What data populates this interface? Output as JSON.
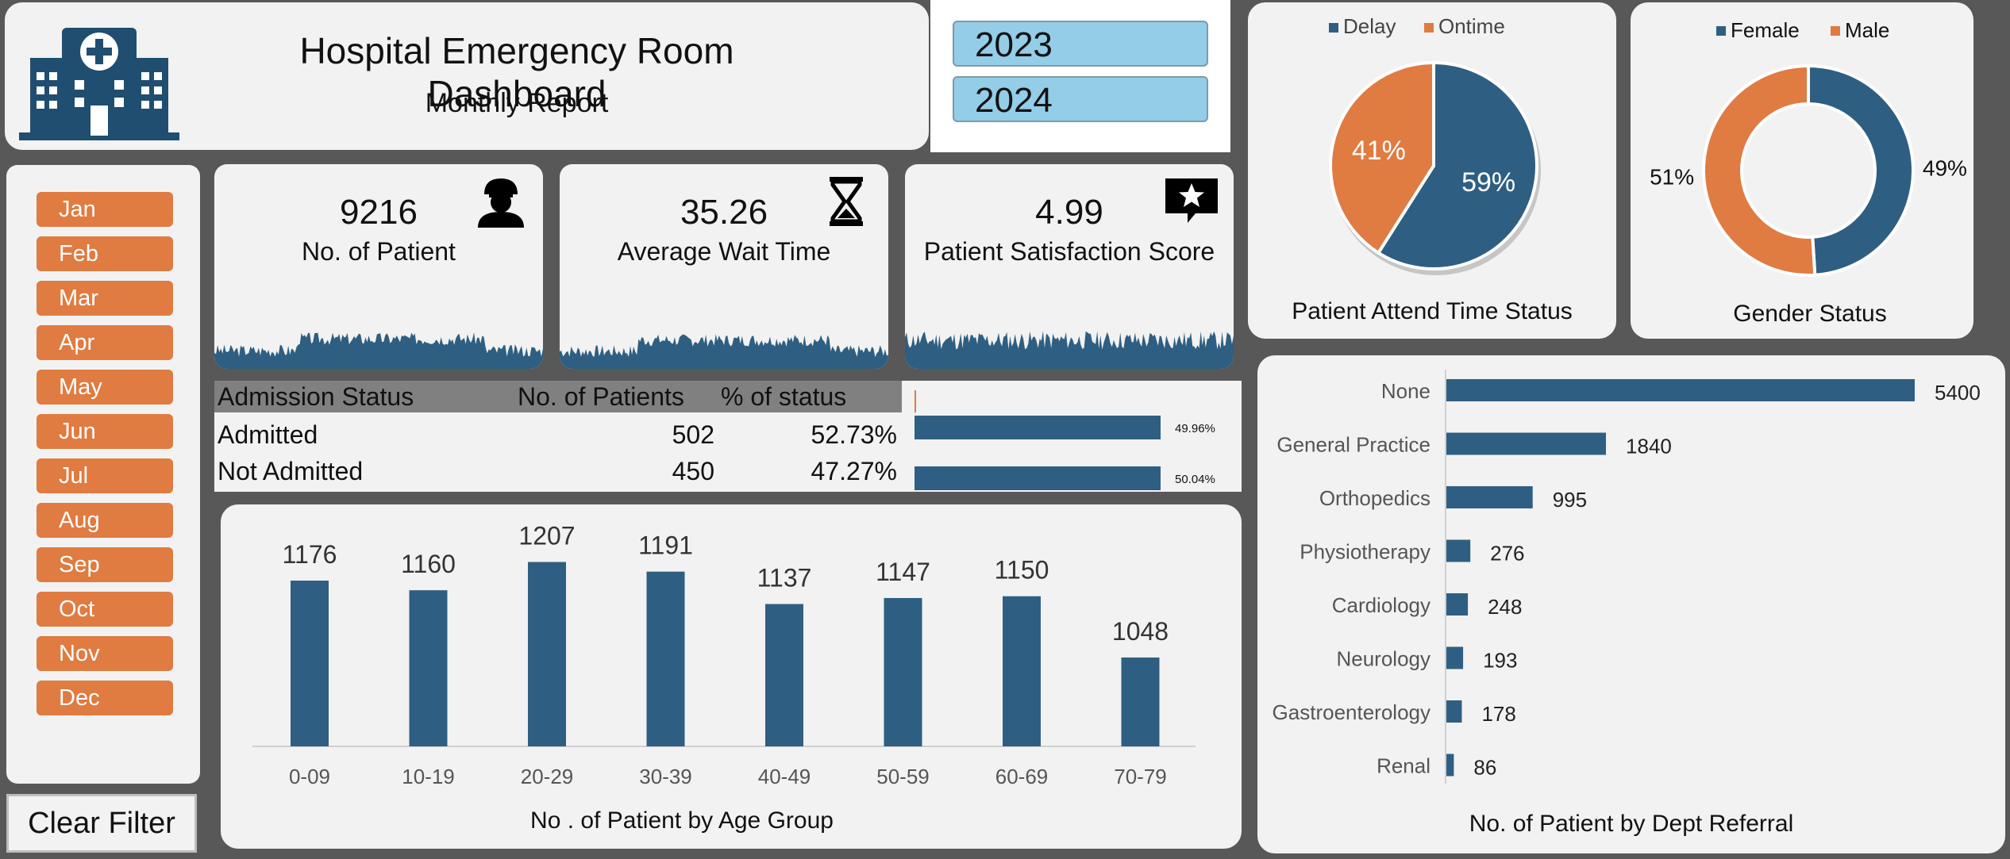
{
  "header": {
    "title": "Hospital Emergency Room Dashboard",
    "subtitle": "Monthly Report",
    "logo_icon": "hospital-icon"
  },
  "years": [
    "2023",
    "2024"
  ],
  "months": [
    "Jan",
    "Feb",
    "Mar",
    "Apr",
    "May",
    "Jun",
    "Jul",
    "Aug",
    "Sep",
    "Oct",
    "Nov",
    "Dec"
  ],
  "clear_filter": "Clear Filter",
  "kpis": [
    {
      "value": "9216",
      "label": "No. of Patient",
      "icon": "doctor-icon"
    },
    {
      "value": "35.26",
      "label": "Average Wait Time",
      "icon": "hourglass-icon"
    },
    {
      "value": "4.99",
      "label": "Patient Satisfaction Score",
      "icon": "rating-star-icon"
    }
  ],
  "admission": {
    "headers": [
      "Admission Status",
      "No. of Patients",
      "% of status"
    ],
    "rows": [
      {
        "status": "Admitted",
        "count": "502",
        "pct": "52.73%",
        "bar_label": "49.96%",
        "bar_value": 49.96
      },
      {
        "status": "Not Admitted",
        "count": "450",
        "pct": "47.27%",
        "bar_label": "50.04%",
        "bar_value": 50.04
      }
    ]
  },
  "colors": {
    "blue": "#2e5f82",
    "orange": "#e07b41",
    "panel": "#f2f2f2",
    "background": "#585858",
    "year_button": "#93cde8"
  },
  "chart_data": [
    {
      "id": "age",
      "type": "bar",
      "title": "No . of Patient by Age Group",
      "categories": [
        "0-09",
        "10-19",
        "20-29",
        "30-39",
        "40-49",
        "50-59",
        "60-69",
        "70-79"
      ],
      "values": [
        1176,
        1160,
        1207,
        1191,
        1137,
        1147,
        1150,
        1048
      ],
      "ylim": [
        900,
        1250
      ]
    },
    {
      "id": "dept",
      "type": "bar",
      "orientation": "horizontal",
      "title": "No. of Patient by Dept Referral",
      "categories": [
        "None",
        "General Practice",
        "Orthopedics",
        "Physiotherapy",
        "Cardiology",
        "Neurology",
        "Gastroenterology",
        "Renal"
      ],
      "values": [
        5400,
        1840,
        995,
        276,
        248,
        193,
        178,
        86
      ]
    },
    {
      "id": "attend",
      "type": "pie",
      "title": "Patient Attend Time Status",
      "legend": [
        "Delay",
        "Ontime"
      ],
      "values": [
        59,
        41
      ],
      "labels": [
        "59%",
        "41%"
      ]
    },
    {
      "id": "gender",
      "type": "pie",
      "donut": true,
      "title": "Gender Status",
      "legend": [
        "Female",
        "Male"
      ],
      "values": [
        49,
        51
      ],
      "labels": [
        "49%",
        "51%"
      ]
    }
  ]
}
